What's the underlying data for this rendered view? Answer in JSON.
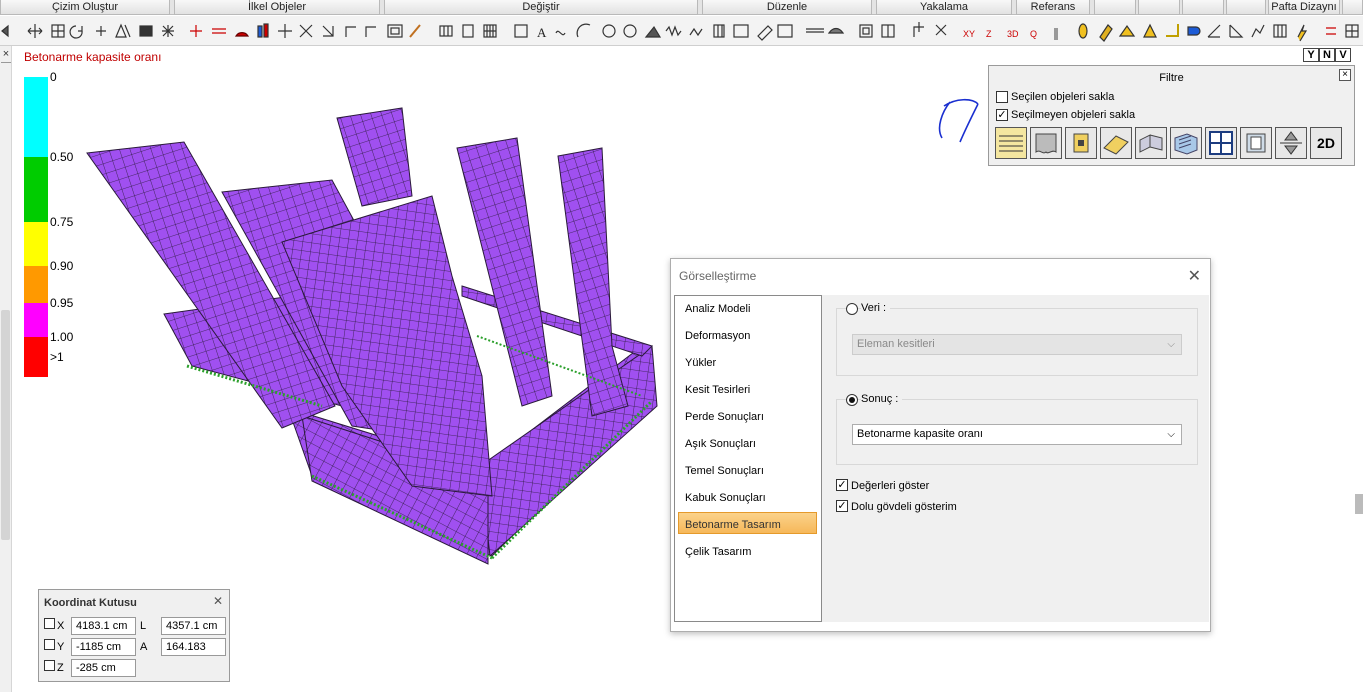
{
  "ribbon": {
    "tabs": [
      "Çizim Oluştur",
      "İlkel Objeler",
      "Değiştir",
      "Düzenle",
      "Yakalama",
      "Referans",
      "Pafta Dizaynı"
    ]
  },
  "viewport": {
    "title": "Betonarme kapasite oranı",
    "legend": {
      "labels": [
        "0",
        "0.50",
        "0.75",
        "0.90",
        "0.95",
        "1.00",
        ">1"
      ],
      "colors": [
        "#00ffff",
        "#00cc00",
        "#ffff00",
        "#ff9900",
        "#ff00ff",
        "#ff0000"
      ]
    },
    "model_colors": {
      "shell": "#a050f0",
      "mesh": "#2a1a3a",
      "supports": "#2ca02c"
    }
  },
  "filter_panel": {
    "title": "Filtre",
    "options": [
      {
        "label": "Seçilen objeleri sakla",
        "checked": false
      },
      {
        "label": "Seçilmeyen objeleri sakla",
        "checked": true
      }
    ],
    "button_icons": [
      "beam-icon",
      "column-icon",
      "slab-icon",
      "wall-icon",
      "brick-wall-icon",
      "grid-icon",
      "box-icon",
      "elevation-icon"
    ],
    "button_2d": "2D",
    "corner_buttons": [
      "Y",
      "N",
      "V"
    ]
  },
  "dialog": {
    "title": "Görselleştirme",
    "nav_items": [
      "Analiz Modeli",
      "Deformasyon",
      "Yükler",
      "Kesit Tesirleri",
      "Perde Sonuçları",
      "Aşık Sonuçları",
      "Temel Sonuçları",
      "Kabuk Sonuçları",
      "Betonarme Tasarım",
      "Çelik Tasarım"
    ],
    "active_nav": "Betonarme Tasarım",
    "veri": {
      "label": "Veri :",
      "selected": false,
      "value": "Eleman kesitleri"
    },
    "sonuc": {
      "label": "Sonuç :",
      "selected": true,
      "value": "Betonarme kapasite oranı"
    },
    "checkboxes": [
      {
        "label": "Değerleri göster",
        "checked": true
      },
      {
        "label": "Dolu gövdeli gösterim",
        "checked": true
      }
    ]
  },
  "coord_box": {
    "title": "Koordinat Kutusu",
    "x_label": "X",
    "x_value": "4183.1 cm",
    "y_label": "Y",
    "y_value": "-1185 cm",
    "z_label": "Z",
    "z_value": "-285 cm",
    "l_label": "L",
    "l_value": "4357.1 cm",
    "a_label": "A",
    "a_value": "164.183"
  }
}
